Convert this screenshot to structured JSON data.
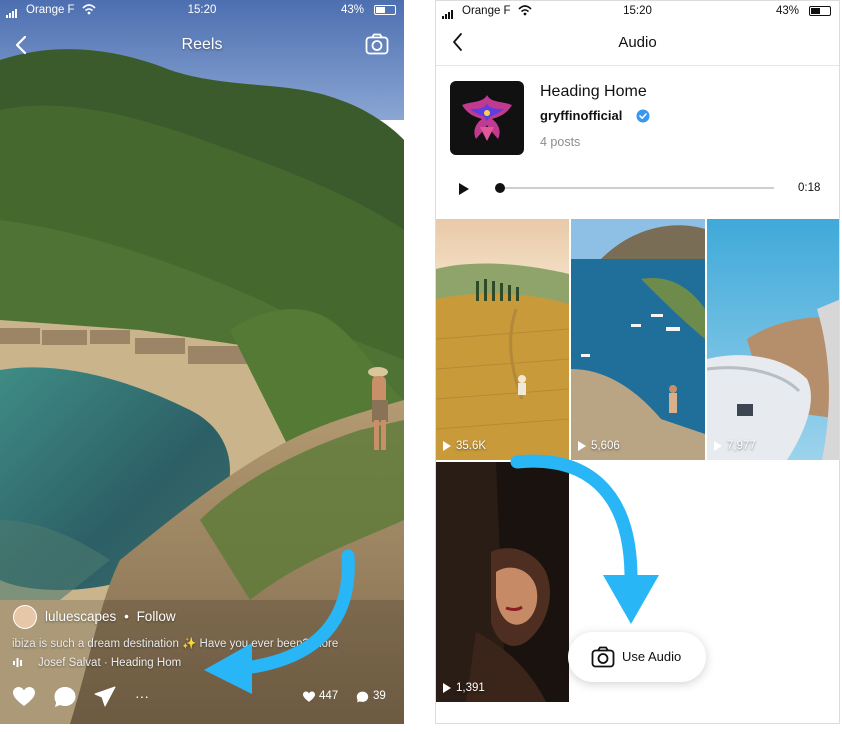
{
  "left": {
    "status": {
      "carrier": "Orange F",
      "time": "15:20",
      "battery": "43%"
    },
    "header": {
      "title": "Reels"
    },
    "post": {
      "username": "luluescapes",
      "separator": "•",
      "follow_label": "Follow",
      "caption": "ibiza is such a dream destination ✨ Have you ever been? more",
      "audio_label": "Josef Salvat · Heading Hom"
    },
    "actions": {
      "more": "···",
      "likes": "447",
      "comments": "39"
    }
  },
  "right": {
    "status": {
      "carrier": "Orange F",
      "time": "15:20",
      "battery": "43%"
    },
    "header": {
      "title": "Audio"
    },
    "audio": {
      "title": "Heading Home",
      "artist": "gryffinofficial",
      "posts": "4 posts",
      "duration": "0:18",
      "progress": 0
    },
    "grid": [
      {
        "views": "35.6K"
      },
      {
        "views": "5,606"
      },
      {
        "views": "7,977"
      },
      {
        "views": "1,391"
      }
    ],
    "use_audio_label": "Use Audio"
  },
  "colors": {
    "accent_arrow": "#29b6f6",
    "verified": "#3897f0"
  }
}
